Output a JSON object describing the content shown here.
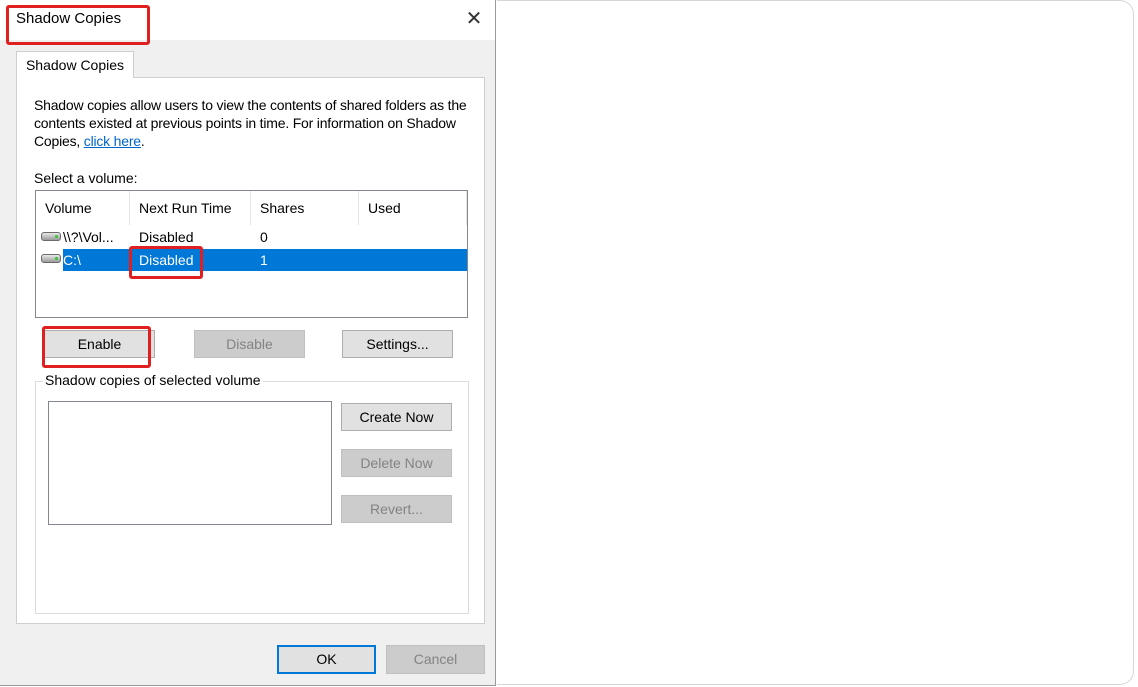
{
  "dialog": {
    "title": "Shadow Copies",
    "close_symbol": "✕",
    "tab_label": "Shadow Copies",
    "description_before_link": "Shadow copies allow users to view the contents of shared folders as the contents existed at previous points in time. For information on Shadow Copies, ",
    "link_text": "click here",
    "description_after_link": ".",
    "select_volume_label": "Select a volume:",
    "columns": [
      "Volume",
      "Next Run Time",
      "Shares",
      "Used"
    ],
    "volumes": [
      {
        "volume": "\\\\?\\Vol...",
        "next_run_time": "Disabled",
        "shares": "0",
        "used": ""
      },
      {
        "volume": "C:\\",
        "next_run_time": "Disabled",
        "shares": "1",
        "used": ""
      }
    ],
    "selected_volume_index": 1,
    "buttons": {
      "enable": "Enable",
      "disable": "Disable",
      "settings": "Settings...",
      "create_now": "Create Now",
      "delete_now": "Delete Now",
      "revert": "Revert...",
      "ok": "OK",
      "cancel": "Cancel"
    },
    "group_label": "Shadow copies of selected volume"
  },
  "colors": {
    "selection": "#0078d7",
    "highlight": "#e02020",
    "link": "#0066cc"
  },
  "icons": {
    "drive": "drive-icon",
    "close": "close-icon"
  }
}
